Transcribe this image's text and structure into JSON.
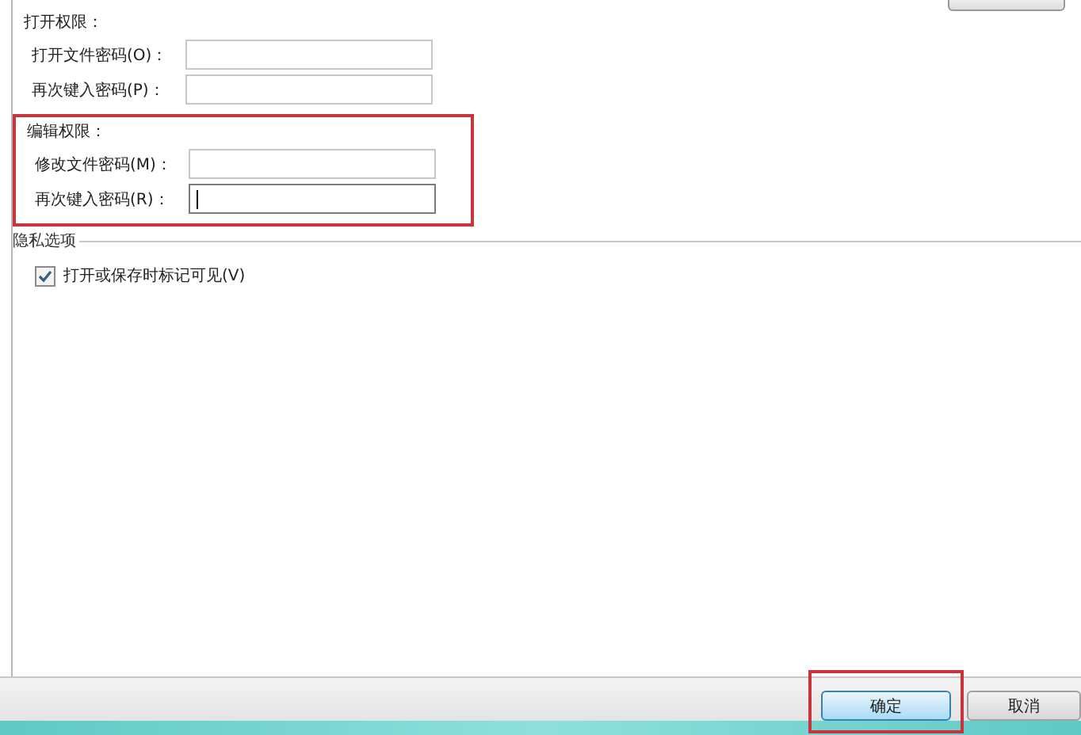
{
  "sections": [
    {
      "title": "打开权限：",
      "highlighted": false,
      "fields": [
        {
          "label": "打开文件密码(O)：",
          "focused": false
        },
        {
          "label": "再次键入密码(P)：",
          "focused": false
        }
      ]
    },
    {
      "title": "编辑权限：",
      "highlighted": true,
      "fields": [
        {
          "label": "修改文件密码(M)：",
          "focused": false
        },
        {
          "label": "再次键入密码(R)：",
          "focused": true
        }
      ]
    }
  ],
  "privacy": {
    "title": "隐私选项",
    "options": [
      {
        "label": "打开或保存时标记可见(V)",
        "checked": true
      }
    ]
  },
  "buttons": [
    {
      "label": "确定",
      "kind": "default",
      "highlighted": true
    },
    {
      "label": "取消",
      "kind": "normal",
      "highlighted": false
    }
  ]
}
